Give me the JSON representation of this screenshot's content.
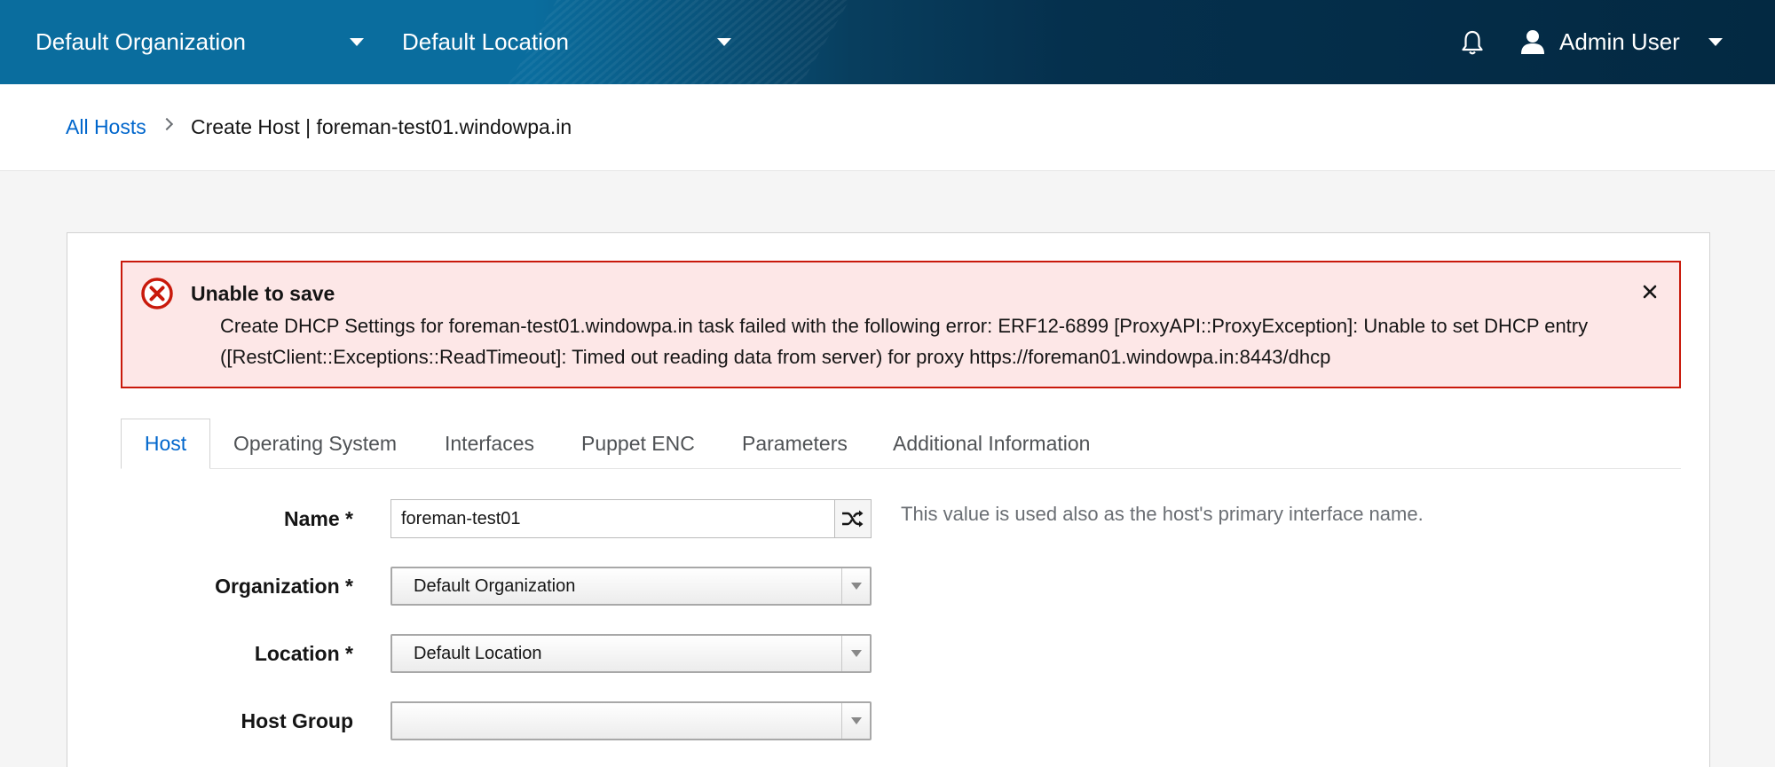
{
  "masthead": {
    "organization": "Default Organization",
    "location": "Default Location",
    "user": "Admin User",
    "icons": [
      "bell-icon",
      "user-icon",
      "caret-down-icon"
    ]
  },
  "breadcrumb": {
    "parent": "All Hosts",
    "current": "Create Host | foreman-test01.windowpa.in"
  },
  "alert": {
    "title": "Unable to save",
    "message": "Create DHCP Settings for foreman-test01.windowpa.in task failed with the following error: ERF12-6899 [ProxyAPI::ProxyException]: Unable to set DHCP entry ([RestClient::Exceptions::ReadTimeout]: Timed out reading data from server) for proxy https://foreman01.windowpa.in:8443/dhcp",
    "color": "#c9190b"
  },
  "tabs": [
    {
      "label": "Host",
      "active": true
    },
    {
      "label": "Operating System",
      "active": false
    },
    {
      "label": "Interfaces",
      "active": false
    },
    {
      "label": "Puppet ENC",
      "active": false
    },
    {
      "label": "Parameters",
      "active": false
    },
    {
      "label": "Additional Information",
      "active": false
    }
  ],
  "form": {
    "name": {
      "label": "Name *",
      "value": "foreman-test01",
      "help": "This value is used also as the host's primary interface name."
    },
    "organization": {
      "label": "Organization *",
      "value": "Default Organization"
    },
    "location": {
      "label": "Location *",
      "value": "Default Location"
    },
    "host_group": {
      "label": "Host Group",
      "value": ""
    }
  },
  "colors": {
    "accent": "#0066cc",
    "masthead": "#032942"
  }
}
